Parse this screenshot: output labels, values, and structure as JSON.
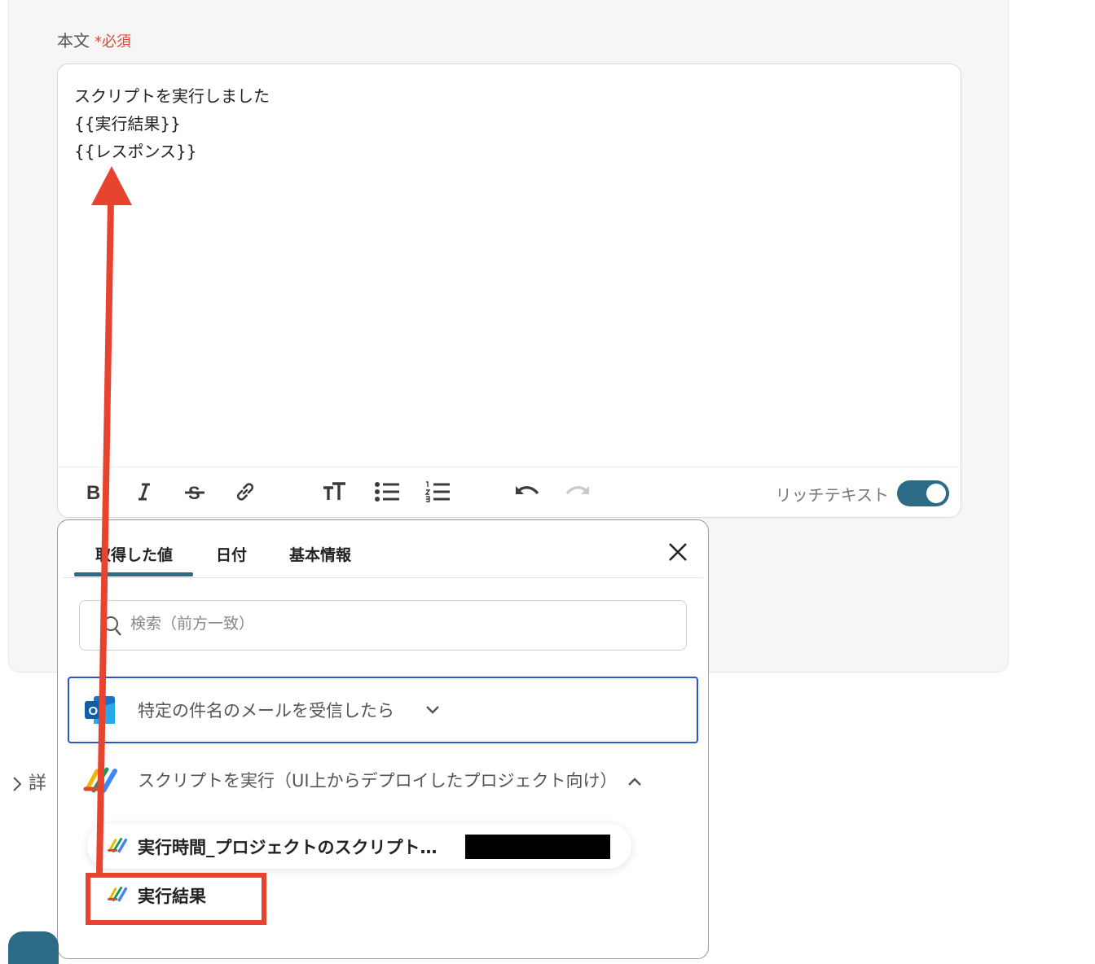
{
  "form": {
    "field_label": "本文",
    "required_mark": "*",
    "required_text": "必須",
    "body_lines": [
      "スクリプトを実行しました",
      "{{実行結果}}",
      "{{レスポンス}}"
    ],
    "rich_text_label": "リッチテキスト",
    "rich_text_enabled": true
  },
  "toolbar": {
    "buttons": [
      "bold-icon",
      "italic-icon",
      "strikethrough-icon",
      "link-icon",
      "text-size-icon",
      "bulleted-list-icon",
      "numbered-list-icon",
      "undo-icon",
      "redo-icon"
    ]
  },
  "popup": {
    "tabs": [
      "取得した値",
      "日付",
      "基本情報"
    ],
    "active_tab": "取得した値",
    "search_placeholder": "検索（前方一致）",
    "groups": [
      {
        "label": "特定の件名のメールを受信したら",
        "icon": "outlook-icon",
        "expanded": false
      },
      {
        "label": "スクリプトを実行（UI上からデプロイしたプロジェクト向け）",
        "icon": "apps-script-icon",
        "expanded": true
      }
    ],
    "items": [
      {
        "label": "実行時間_プロジェクトのスクリプト…",
        "icon": "apps-script-icon"
      },
      {
        "label": "実行結果",
        "icon": "apps-script-icon"
      }
    ]
  },
  "details_label": "詳",
  "colors": {
    "accent": "#2c6a85",
    "annotation": "#e8432e",
    "required": "#e0463a",
    "selected_border": "#2a55c7"
  }
}
